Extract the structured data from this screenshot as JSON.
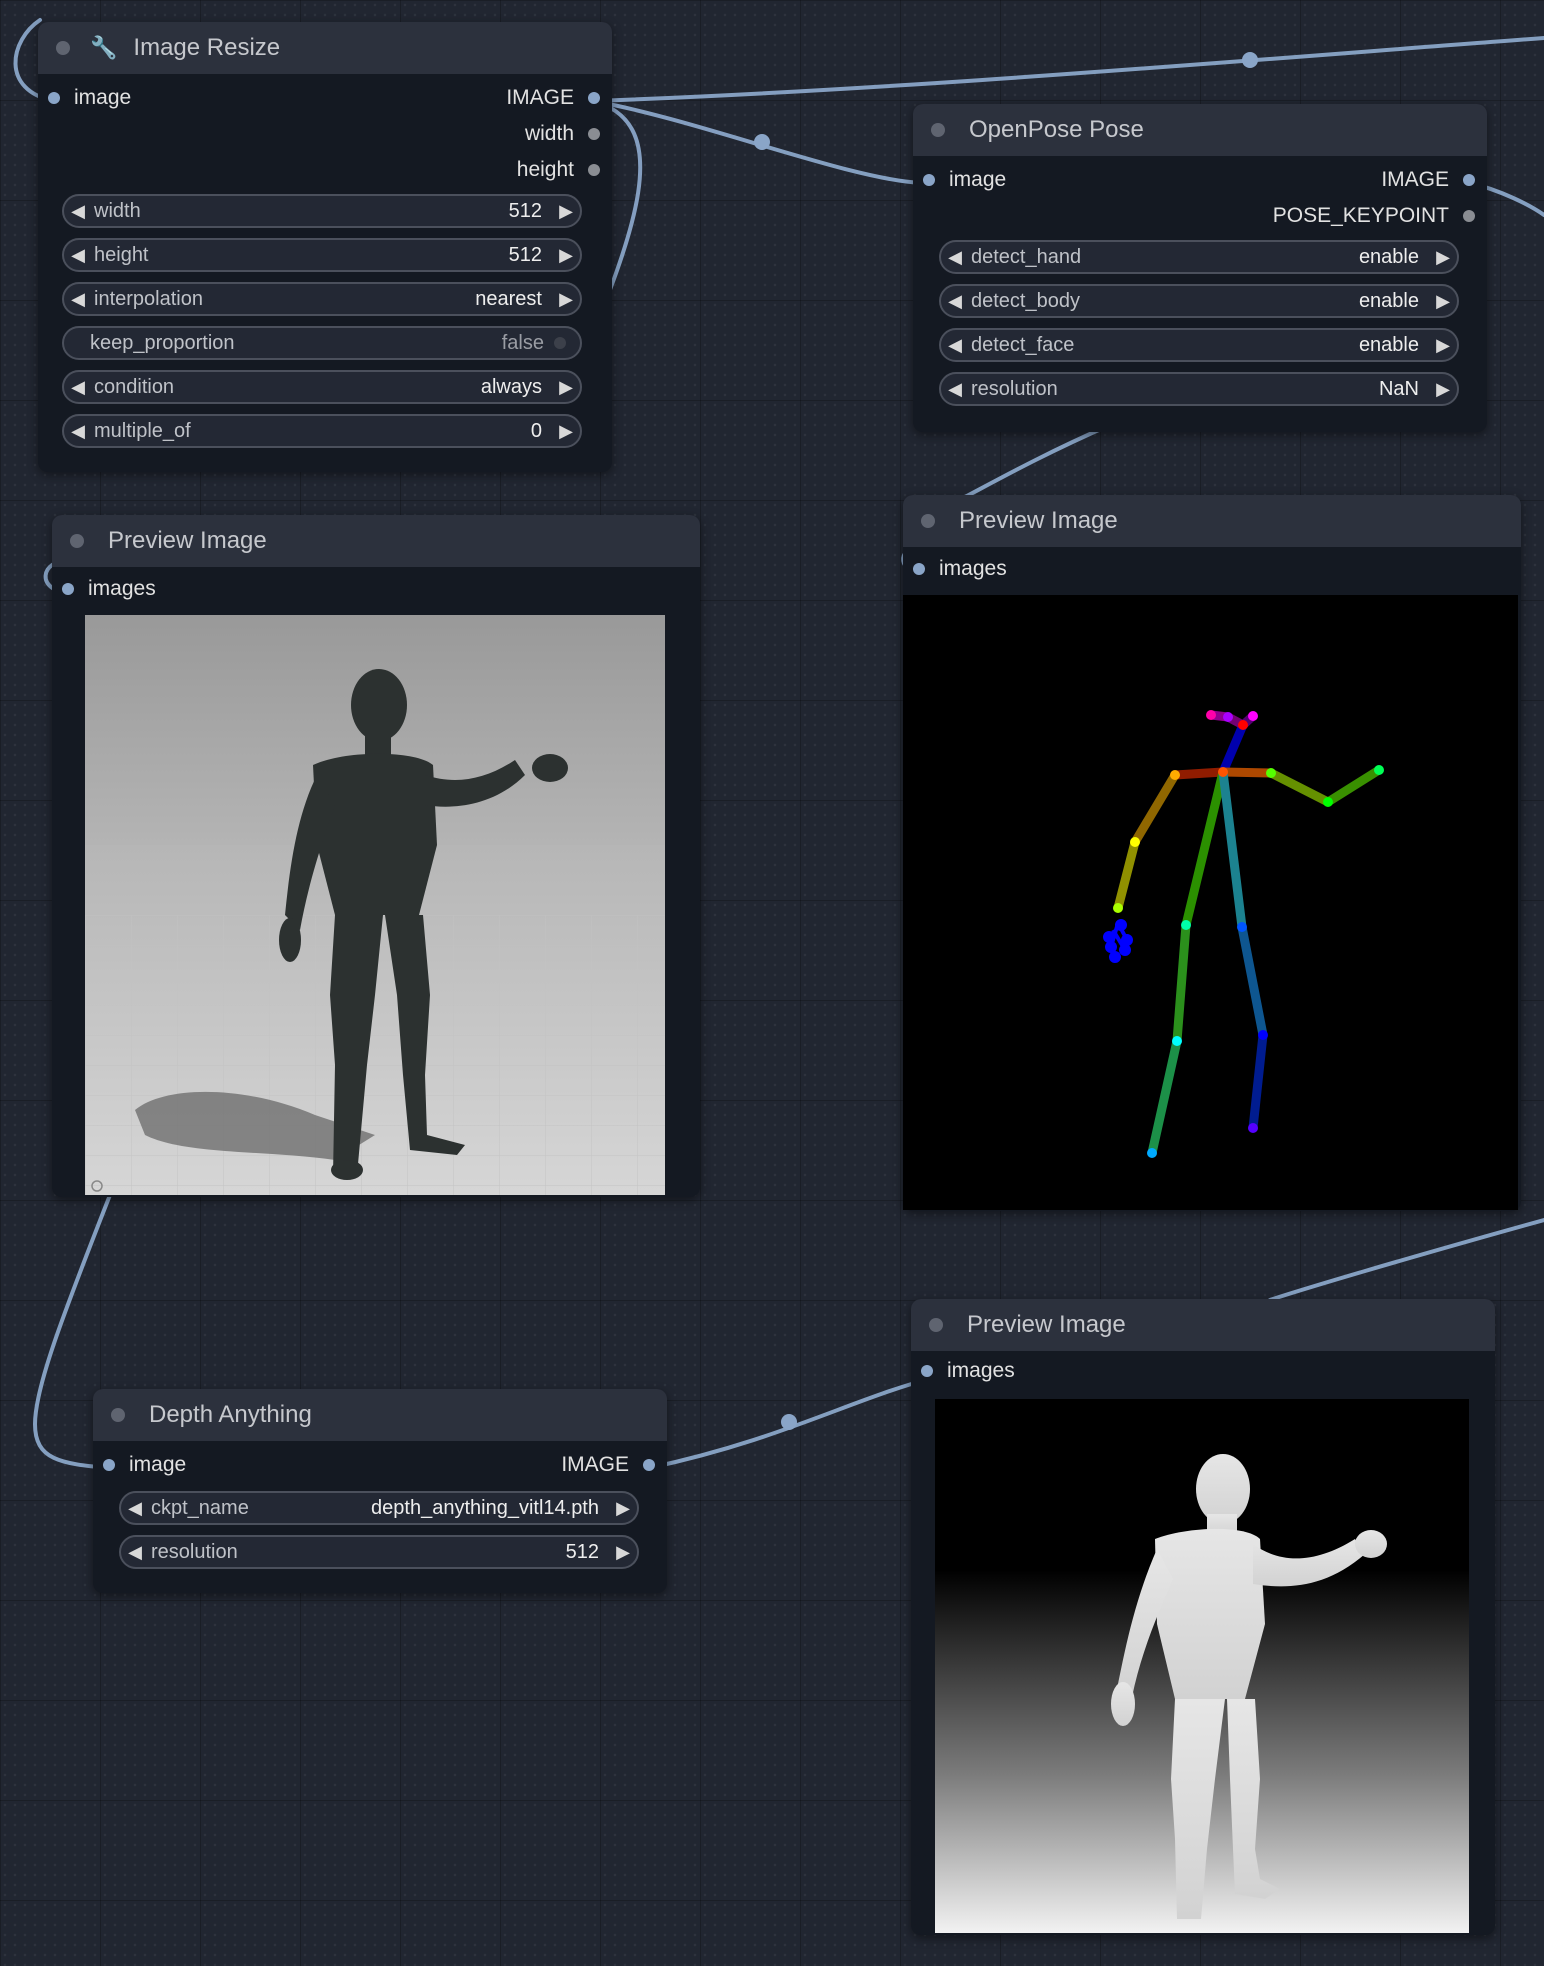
{
  "nodes": {
    "image_resize": {
      "title": "Image Resize",
      "icon": "wrench-icon",
      "input": "image",
      "outputs": [
        "IMAGE",
        "width",
        "height"
      ],
      "widgets": [
        {
          "label": "width",
          "value": "512"
        },
        {
          "label": "height",
          "value": "512"
        },
        {
          "label": "interpolation",
          "value": "nearest"
        },
        {
          "label": "keep_proportion",
          "value": "false"
        },
        {
          "label": "condition",
          "value": "always"
        },
        {
          "label": "multiple_of",
          "value": "0"
        }
      ]
    },
    "openpose": {
      "title": "OpenPose Pose",
      "input": "image",
      "outputs": [
        "IMAGE",
        "POSE_KEYPOINT"
      ],
      "widgets": [
        {
          "label": "detect_hand",
          "value": "enable"
        },
        {
          "label": "detect_body",
          "value": "enable"
        },
        {
          "label": "detect_face",
          "value": "enable"
        },
        {
          "label": "resolution",
          "value": "NaN"
        }
      ]
    },
    "preview_original": {
      "title": "Preview Image",
      "input": "images"
    },
    "preview_pose": {
      "title": "Preview Image",
      "input": "images"
    },
    "preview_depth": {
      "title": "Preview Image",
      "input": "images"
    },
    "depth_anything": {
      "title": "Depth Anything",
      "input": "image",
      "output": "IMAGE",
      "widgets": [
        {
          "label": "ckpt_name",
          "value": "depth_anything_vitl14.pth"
        },
        {
          "label": "resolution",
          "value": "512"
        }
      ]
    }
  },
  "colors": {
    "canvas": "#212631",
    "node_body": "#141922",
    "node_header": "#2c313d",
    "wire": "#8aa5c8",
    "slot_connected": "#8aa5c8"
  }
}
